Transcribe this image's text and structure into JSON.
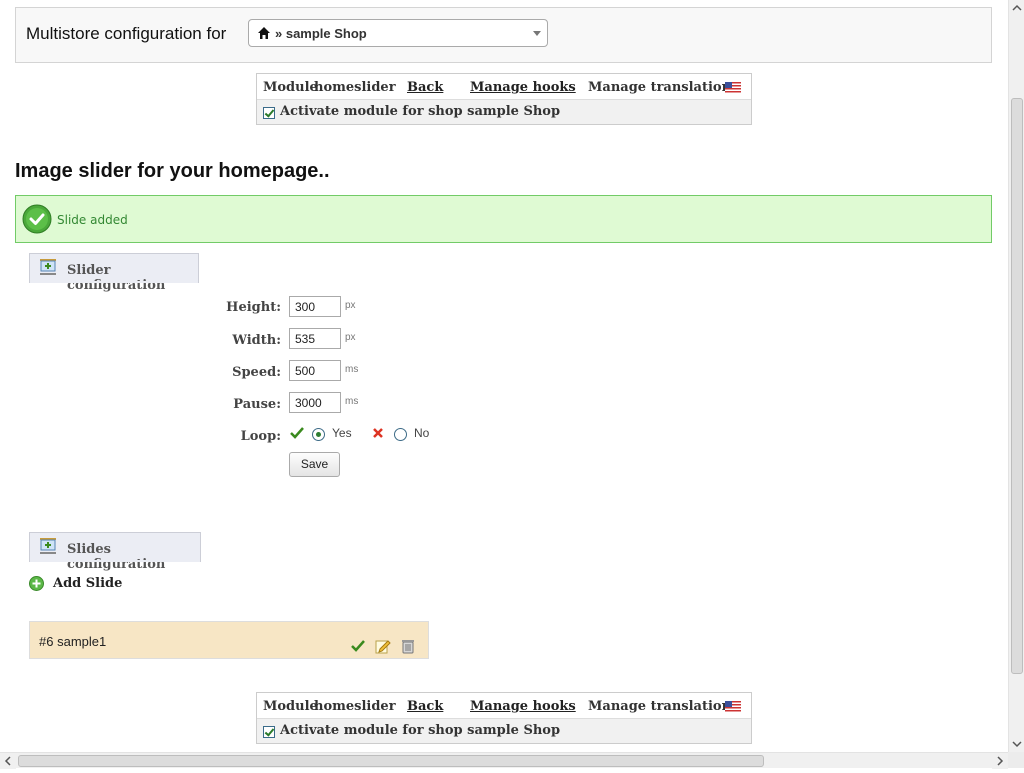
{
  "multistore": {
    "label": "Multistore configuration for",
    "selected": "» sample Shop"
  },
  "toolbar": {
    "module_prefix": "Module",
    "module_name": "homeslider",
    "back": "Back",
    "manage_hooks": "Manage hooks",
    "manage_translations": "Manage translations",
    "activate_label": "Activate module for shop sample Shop",
    "activate_checked": true
  },
  "page_title": "Image slider for your homepage..",
  "confirmation": "Slide added",
  "slider_config": {
    "legend": "Slider configuration",
    "fields": {
      "height": {
        "label": "Height:",
        "value": "300",
        "unit": "px"
      },
      "width": {
        "label": "Width:",
        "value": "535",
        "unit": "px"
      },
      "speed": {
        "label": "Speed:",
        "value": "500",
        "unit": "ms"
      },
      "pause": {
        "label": "Pause:",
        "value": "3000",
        "unit": "ms"
      }
    },
    "loop": {
      "label": "Loop:",
      "yes": "Yes",
      "no": "No",
      "selected": "Yes"
    },
    "save": "Save"
  },
  "slides_config": {
    "legend": "Slides configuration",
    "add_slide": "Add Slide",
    "slides": [
      {
        "id": "#6",
        "title": "sample1"
      }
    ]
  },
  "colors": {
    "accent_green": "#3a8a1e",
    "success_bg": "#dffad3",
    "panel_bg": "#ebedf4",
    "slide_row_bg": "#f7e6c5"
  }
}
